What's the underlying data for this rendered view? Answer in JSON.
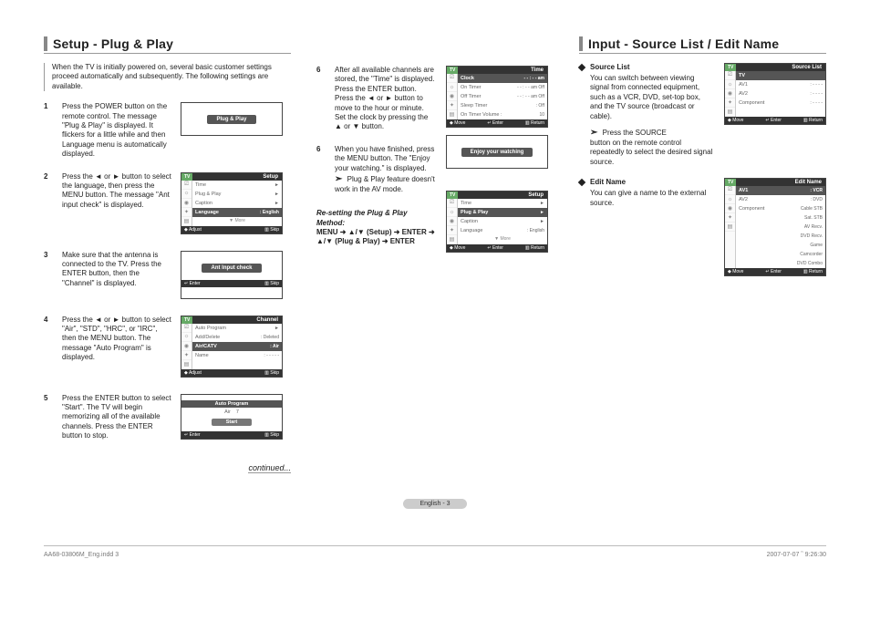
{
  "section1": {
    "title": "Setup - Plug & Play",
    "intro": "When the TV is initially powered on, several basic customer settings proceed automatically and subsequently. The following settings are available.",
    "steps": {
      "s1": "Press the POWER button on the remote control. The message \"Plug & Play\" is displayed. It flickers for a little while and then Language menu is automatically displayed.",
      "s2": "Press the ◄ or ► button to select the language, then press the MENU button. The message \"Ant input check\" is displayed.",
      "s3": "Make sure that the antenna is connected to the TV. Press the ENTER button, then the \"Channel\" is displayed.",
      "s4": "Press the ◄ or ► button to select \"Air\", \"STD\", \"HRC\", or \"IRC\", then the MENU button. The message \"Auto Program\" is displayed.",
      "s5": "Press the ENTER button to select \"Start\". The TV will begin memorizing all of the available channels. Press the ENTER button to stop.",
      "s6a": "After all available channels are stored, the \"Time\" is displayed. Press the ENTER button. Press the ◄ or ► button to move to the hour or minute. Set the clock by pressing the ▲ or ▼ button.",
      "s6b": "When you have finished, press the MENU button. The \"Enjoy your watching.\" is displayed.",
      "s6b_note": "Plug & Play feature doesn't work in the AV mode."
    },
    "reset": {
      "title": "Re-setting the Plug & Play Method:",
      "line": "MENU ➜ ▲/▼ (Setup) ➜ ENTER ➜ ▲/▼ (Plug & Play) ➜ ENTER"
    },
    "continued": "continued..."
  },
  "osd": {
    "tv": "TV",
    "setup_title": "Setup",
    "time_title": "Time",
    "channel_title": "Channel",
    "sourcelist_title": "Source List",
    "editname_title": "Edit Name",
    "plugplay_pill": "Plug & Play",
    "antcheck_pill": "Ant Input check",
    "enjoy_pill": "Enjoy your watching",
    "autoprogram_pill": "Auto Program",
    "autoprogram_foot": "Auto Program",
    "air_label": "Air",
    "air_val": "7",
    "start_label": "Start",
    "setup_rows": {
      "time": "Time",
      "plugplay": "Plug & Play",
      "caption": "Caption",
      "language": "Language",
      "language_val": ": English"
    },
    "channel_rows": {
      "autoprogram": "Auto Program",
      "adddelete": "Add/Delete",
      "adddelete_val": ": Deleted",
      "aircatv": "Air/CATV",
      "aircatv_val": ": Air",
      "name": "Name",
      "name_val": ": - - - - -"
    },
    "time_rows": {
      "clock": "Clock",
      "clock_val": "- - : - -  am",
      "ontimer": "On Timer",
      "ontimer_val": "- - : - -  am   Off",
      "offtimer": "Off Timer",
      "offtimer_val": "- - : - -  am   Off",
      "sleeptimer": "Sleep Timer",
      "sleeptimer_val": ": Off",
      "ontimervol": "On Timer Volume :",
      "ontimervol_val": "10"
    },
    "sourcelist_rows": {
      "tv": "TV",
      "av1": "AV1",
      "av1_val": ": - - - -",
      "av2": "AV2",
      "av2_val": ": - - - -",
      "component": "Component",
      "component_val": ": - - - -"
    },
    "editname_rows": {
      "av1": "AV1",
      "av1_val": ": VCR",
      "av2": "AV2",
      "av2_val": ": DVD",
      "component": "Component",
      "opts1": "Cable STB",
      "opts2": "Sat. STB",
      "opts3": "AV Recv.",
      "opts4": "DVD Recv.",
      "opts5": "Game",
      "opts6": "Camcorder",
      "opts7": "DVD Combo"
    },
    "more": "▼ More",
    "foot": {
      "adjust": "◆ Adjust",
      "skip": "▥ Skip",
      "enter": "↵ Enter",
      "move": "◆ Move",
      "return": "▥ Return"
    }
  },
  "section2": {
    "title": "Input - Source List / Edit Name",
    "sourcelist": {
      "head": "Source List",
      "body": "You can switch between viewing signal from connected equipment, such as a VCR, DVD, set-top box, and the TV source (broadcast or cable).",
      "press1": "Press the SOURCE",
      "press2": "button on the remote control repeatedly to select the desired signal source."
    },
    "editname": {
      "head": "Edit Name",
      "body": "You can give a name to the external source."
    }
  },
  "pagefoot": "English - 3",
  "crop": {
    "left": "AA68-03806M_Eng.indd   3",
    "right": "2007-07-07   ῝ 9:26:30"
  }
}
